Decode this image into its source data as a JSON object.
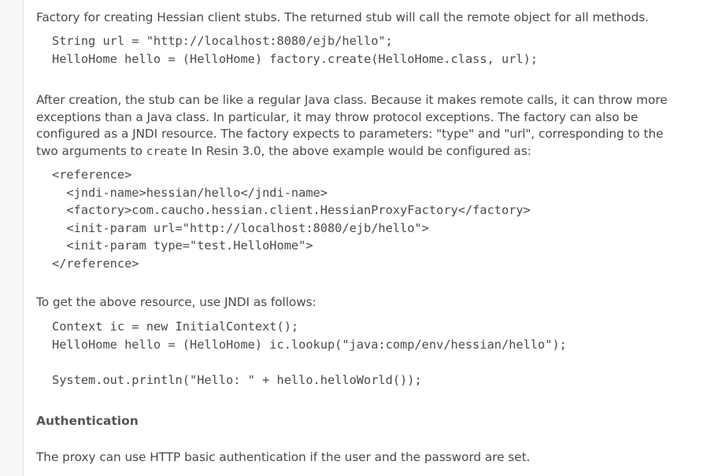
{
  "paragraphs": {
    "intro": "Factory for creating Hessian client stubs. The returned stub will call the remote object for all methods.",
    "after_creation_part1": "After creation, the stub can be like a regular Java class. Because it makes remote calls, it can throw more exceptions than a Java class. In particular, it may throw protocol exceptions. The factory can also be configured as a JNDI resource. The factory expects to parameters: \"type\" and \"url\", corresponding to the two arguments to ",
    "after_creation_code": "create",
    "after_creation_part2": " In Resin 3.0, the above example would be configured as:",
    "jndi_intro": "To get the above resource, use JNDI as follows:",
    "auth_text": "The proxy can use HTTP basic authentication if the user and the password are set."
  },
  "headings": {
    "authentication": "Authentication"
  },
  "code_blocks": {
    "factory_example": [
      "String url = \"http://localhost:8080/ejb/hello\";",
      "HelloHome hello = (HelloHome) factory.create(HelloHome.class, url);"
    ],
    "resin_config": [
      "<reference>",
      "  <jndi-name>hessian/hello</jndi-name>",
      "  <factory>com.caucho.hessian.client.HessianProxyFactory</factory>",
      "  <init-param url=\"http://localhost:8080/ejb/hello\">",
      "  <init-param type=\"test.HelloHome\">",
      "</reference>"
    ],
    "jndi_lookup": [
      "Context ic = new InitialContext();",
      "HelloHome hello = (HelloHome) ic.lookup(\"java:comp/env/hessian/hello\");",
      "",
      "System.out.println(\"Hello: \" + hello.helloWorld());"
    ]
  }
}
